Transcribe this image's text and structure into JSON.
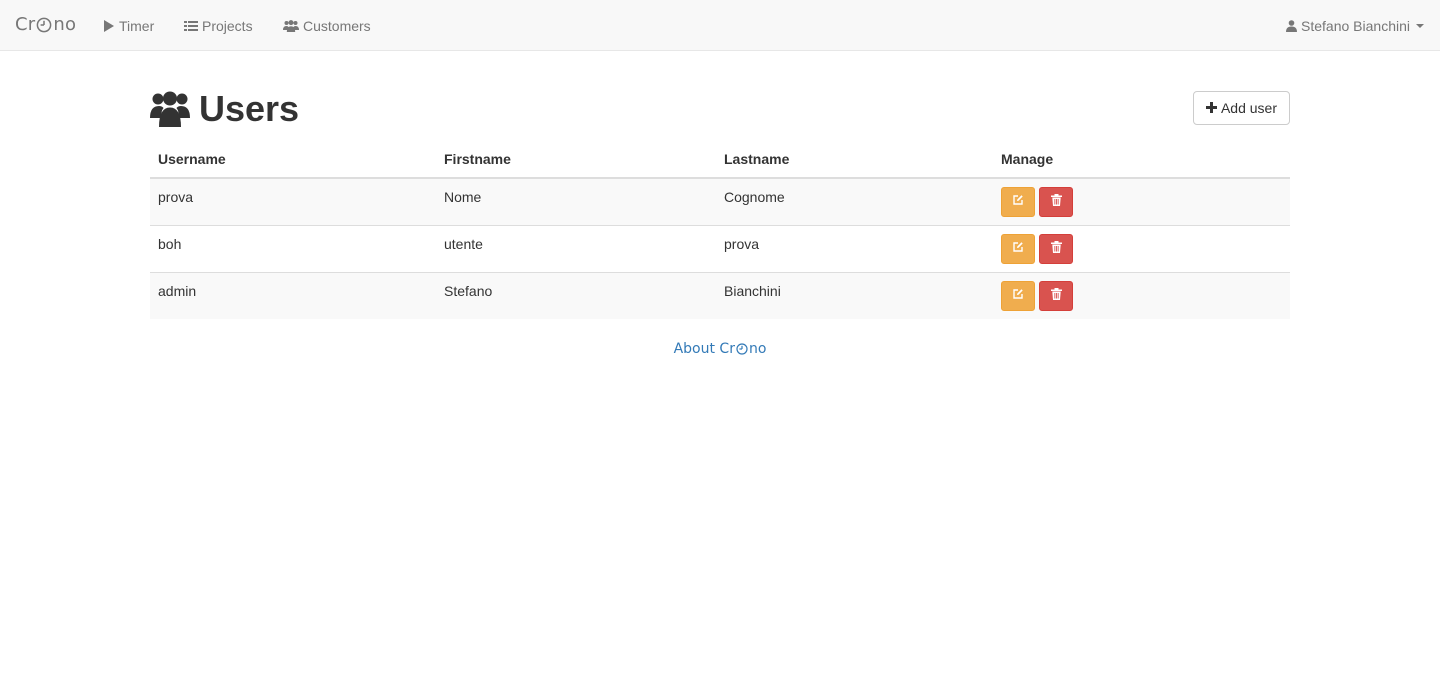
{
  "navbar": {
    "brand": {
      "prefix": "Cr",
      "suffix": "no",
      "icon": "clock-icon"
    },
    "items": [
      {
        "label": "Timer",
        "icon": "play-icon"
      },
      {
        "label": "Projects",
        "icon": "list-icon"
      },
      {
        "label": "Customers",
        "icon": "users-icon"
      }
    ],
    "user": {
      "label": "Stefano Bianchini",
      "icon": "user-icon"
    }
  },
  "page": {
    "title": "Users",
    "title_icon": "users-icon",
    "add_button": {
      "label": "Add user",
      "icon": "plus-icon"
    }
  },
  "table": {
    "headers": [
      "Username",
      "Firstname",
      "Lastname",
      "Manage"
    ],
    "rows": [
      {
        "username": "prova",
        "firstname": "Nome",
        "lastname": "Cognome"
      },
      {
        "username": "boh",
        "firstname": "utente",
        "lastname": "prova"
      },
      {
        "username": "admin",
        "firstname": "Stefano",
        "lastname": "Bianchini"
      }
    ]
  },
  "footer": {
    "link_prefix": "About Cr",
    "link_suffix": "no"
  },
  "colors": {
    "edit": "#f0ad4e",
    "delete": "#d9534f",
    "link": "#337ab7",
    "nav_text": "#777777"
  }
}
